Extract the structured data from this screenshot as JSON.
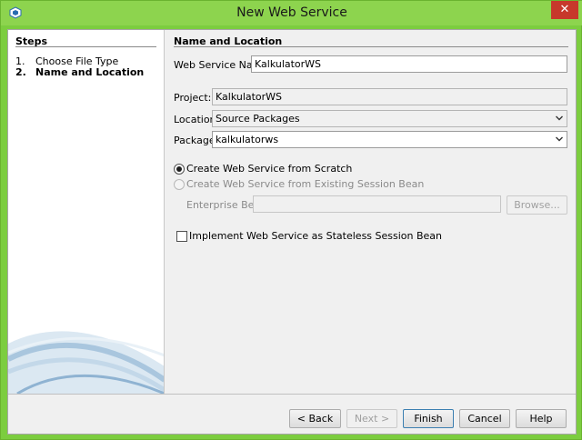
{
  "window": {
    "title": "New Web Service",
    "close_glyph": "✕"
  },
  "steps": {
    "title": "Steps",
    "items": [
      {
        "num": "1.",
        "label": "Choose File Type"
      },
      {
        "num": "2.",
        "label": "Name and Location"
      }
    ]
  },
  "form": {
    "section_title": "Name and Location",
    "web_service_name_label": "Web Service Name:",
    "web_service_name_value": "KalkulatorWS",
    "project_label": "Project:",
    "project_value": "KalkulatorWS",
    "location_label": "Location:",
    "location_value": "Source Packages",
    "package_label": "Package:",
    "package_value": "kalkulatorws",
    "radio_scratch_label": "Create Web Service from Scratch",
    "radio_session_label": "Create Web Service from Existing Session Bean",
    "enterprise_bean_label": "Enterprise Bean:",
    "enterprise_bean_value": "",
    "browse_label": "Browse...",
    "stateless_label": "Implement Web Service as Stateless Session Bean"
  },
  "buttons": {
    "back": "< Back",
    "next": "Next >",
    "finish": "Finish",
    "cancel": "Cancel",
    "help": "Help"
  },
  "colors": {
    "titlebar": "#8dd44e",
    "close_button": "#c7382b",
    "client_bg": "#f0f0f0"
  },
  "icons": {
    "app": "netbeans-cube-icon",
    "close": "close-icon",
    "dropdown": "chevron-down-icon"
  }
}
